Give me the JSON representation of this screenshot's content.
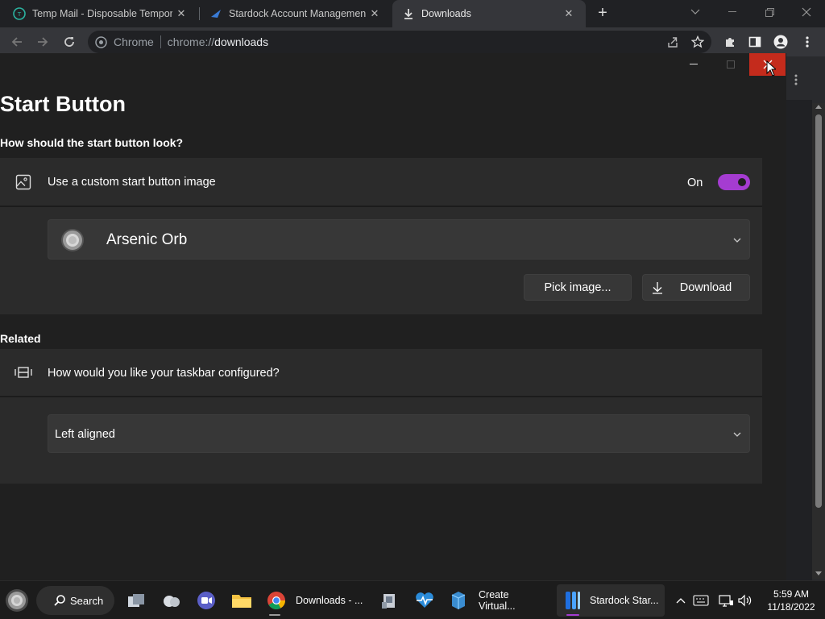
{
  "browser": {
    "tabs": [
      {
        "title": "Temp Mail - Disposable Temporary Email"
      },
      {
        "title": "Stardock Account Management"
      },
      {
        "title": "Downloads"
      }
    ],
    "omnibox": {
      "chip": "Chrome",
      "scheme": "chrome://",
      "host": "downloads"
    }
  },
  "app": {
    "title": "Start Button",
    "section1": "How should the start button look?",
    "custom_image_label": "Use a custom start button image",
    "toggle_state": "On",
    "toggle_on": true,
    "orb_selected": "Arsenic Orb",
    "pick_image": "Pick image...",
    "download": "Download",
    "related": "Related",
    "taskbar_question": "How would you like your taskbar configured?",
    "alignment_selected": "Left aligned",
    "accent_color": "#a53cd1",
    "close_hover_color": "#c42b1c"
  },
  "taskbar": {
    "search": "Search",
    "chrome_label": "Downloads - ...",
    "vbox_label": "Create Virtual...",
    "stardock_label": "Stardock Star...",
    "time": "5:59 AM",
    "date": "11/18/2022"
  }
}
